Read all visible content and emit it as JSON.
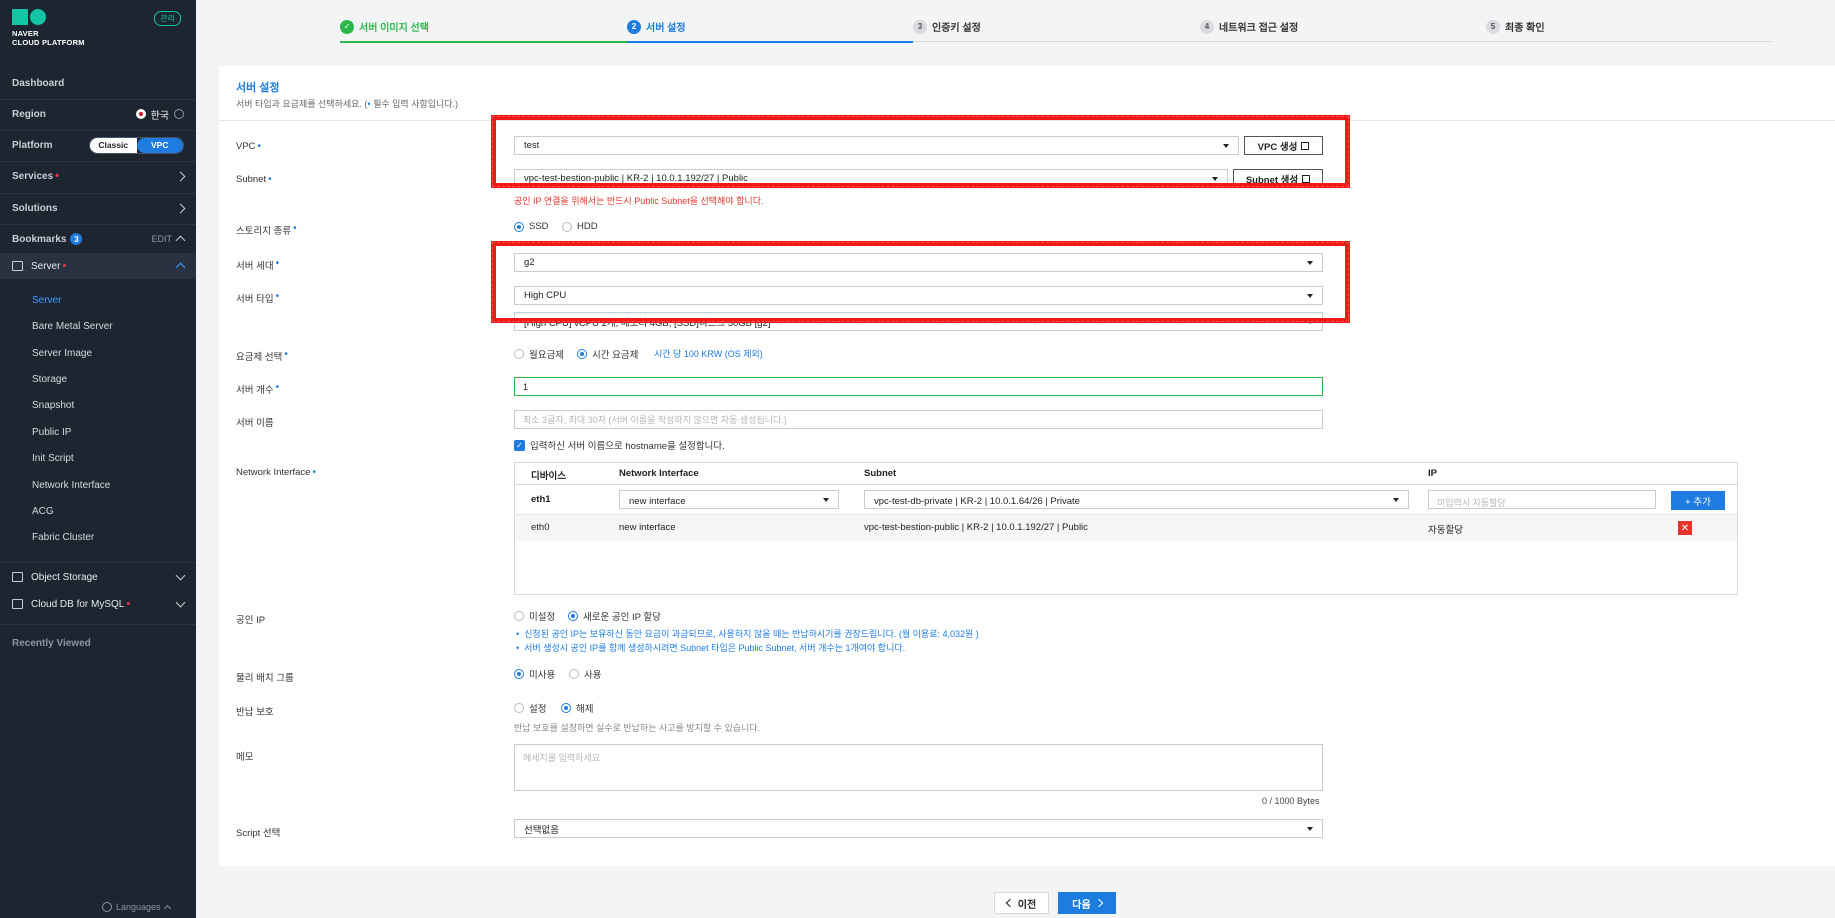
{
  "sidebar": {
    "logo_line1": "NAVER",
    "logo_line2": "CLOUD PLATFORM",
    "mgmt_badge": "관리",
    "dashboard": "Dashboard",
    "region_label": "Region",
    "region_value": "한국",
    "platform_label": "Platform",
    "platform_classic": "Classic",
    "platform_vpc": "VPC",
    "services": "Services",
    "solutions": "Solutions",
    "bookmarks": "Bookmarks",
    "bookmarks_count": "3",
    "bookmarks_edit": "EDIT",
    "server": "Server",
    "server_items": [
      "Server",
      "Bare Metal Server",
      "Server Image",
      "Storage",
      "Snapshot",
      "Public IP",
      "Init Script",
      "Network Interface",
      "ACG",
      "Fabric Cluster"
    ],
    "object_storage": "Object Storage",
    "cloud_db": "Cloud DB for MySQL",
    "recently_viewed": "Recently Viewed",
    "languages": "Languages"
  },
  "steps": [
    {
      "num": "✓",
      "label": "서버 이미지 선택"
    },
    {
      "num": "2",
      "label": "서버 설정"
    },
    {
      "num": "3",
      "label": "인증키 설정"
    },
    {
      "num": "4",
      "label": "네트워크 접근 설정"
    },
    {
      "num": "5",
      "label": "최종 확인"
    }
  ],
  "card": {
    "title": "서버 설정",
    "desc_pre": "서버 타입과 요금제를 선택하세요. (",
    "desc_dot": "•",
    "desc_post": " 필수 입력 사항입니다.)"
  },
  "form": {
    "vpc_label": "VPC",
    "vpc_value": "test",
    "vpc_create": "VPC 생성",
    "subnet_label": "Subnet",
    "subnet_value": "vpc-test-bestion-public | KR-2 | 10.0.1.192/27 | Public",
    "subnet_create": "Subnet 생성",
    "subnet_warning": "공인 IP 연결을 위해서는 반드시 Public Subnet을 선택해야 합니다.",
    "storage_label": "스토리지 종류",
    "storage_ssd": "SSD",
    "storage_hdd": "HDD",
    "gen_label": "서버 세대",
    "gen_value": "g2",
    "type_label": "서버 타입",
    "type_value": "High CPU",
    "spec_value": "[High CPU] vCPU 2개, 메모리 4GB, [SSD]디스크 50GB [g2]",
    "billing_label": "요금제 선택",
    "billing_monthly": "월요금제",
    "billing_hourly": "시간 요금제",
    "billing_info": "시간 당 100 KRW (OS 제외)",
    "count_label": "서버 개수",
    "count_value": "1",
    "name_label": "서버 이름",
    "name_placeholder": "최소 3글자, 최대 30자 (서버 이름을 작성하지 않으면 자동 생성됩니다.)",
    "hostname_check": "입력하신 서버 이름으로 hostname을 설정합니다.",
    "ni_label": "Network Interface",
    "ni_headers": [
      "디바이스",
      "Network Interface",
      "Subnet",
      "IP"
    ],
    "ni_row1": {
      "device": "eth1",
      "ni": "new interface",
      "subnet": "vpc-test-db-private | KR-2 | 10.0.1.64/26 | Private",
      "ip_placeholder": "미입력시 자동할당"
    },
    "ni_add": "+ 추가",
    "ni_row2": {
      "device": "eth0",
      "ni": "new interface",
      "subnet": "vpc-test-bestion-public | KR-2 | 10.0.1.192/27 | Public",
      "ip": "자동할당"
    },
    "ni_remove": "✕",
    "publicip_label": "공인 IP",
    "publicip_none": "미설정",
    "publicip_new": "새로운 공인 IP 할당",
    "publicip_info1": "신청된 공인 IP는 보유하신 동안 요금이 과금되므로, 사용하지 않을 때는 반납하시기를 권장드립니다. (월 이용료: 4,032원 )",
    "publicip_info2": "서버 생성시 공인 IP를 함께 생성하시려면 Subnet 타입은 Public Subnet, 서버 개수는 1개여야 합니다.",
    "placement_label": "물리 배치 그룹",
    "placement_unused": "미사용",
    "placement_used": "사용",
    "protect_label": "반납 보호",
    "protect_on": "설정",
    "protect_off": "해제",
    "protect_hint": "반납 보호를 설정하면 실수로 반납하는 사고를 방지할 수 있습니다.",
    "memo_label": "메모",
    "memo_placeholder": "메세지를 입력하세요",
    "memo_counter": "0 / 1000 Bytes",
    "script_label": "Script 선택",
    "script_value": "선택없음"
  },
  "nav": {
    "prev": "이전",
    "next": "다음"
  },
  "colors": {
    "accent": "#1e7ce0",
    "success": "#2db84c",
    "error": "#e5352b",
    "sidebar_bg": "#1d2530",
    "brand": "#13c4a5",
    "annotation": "#f21818"
  }
}
